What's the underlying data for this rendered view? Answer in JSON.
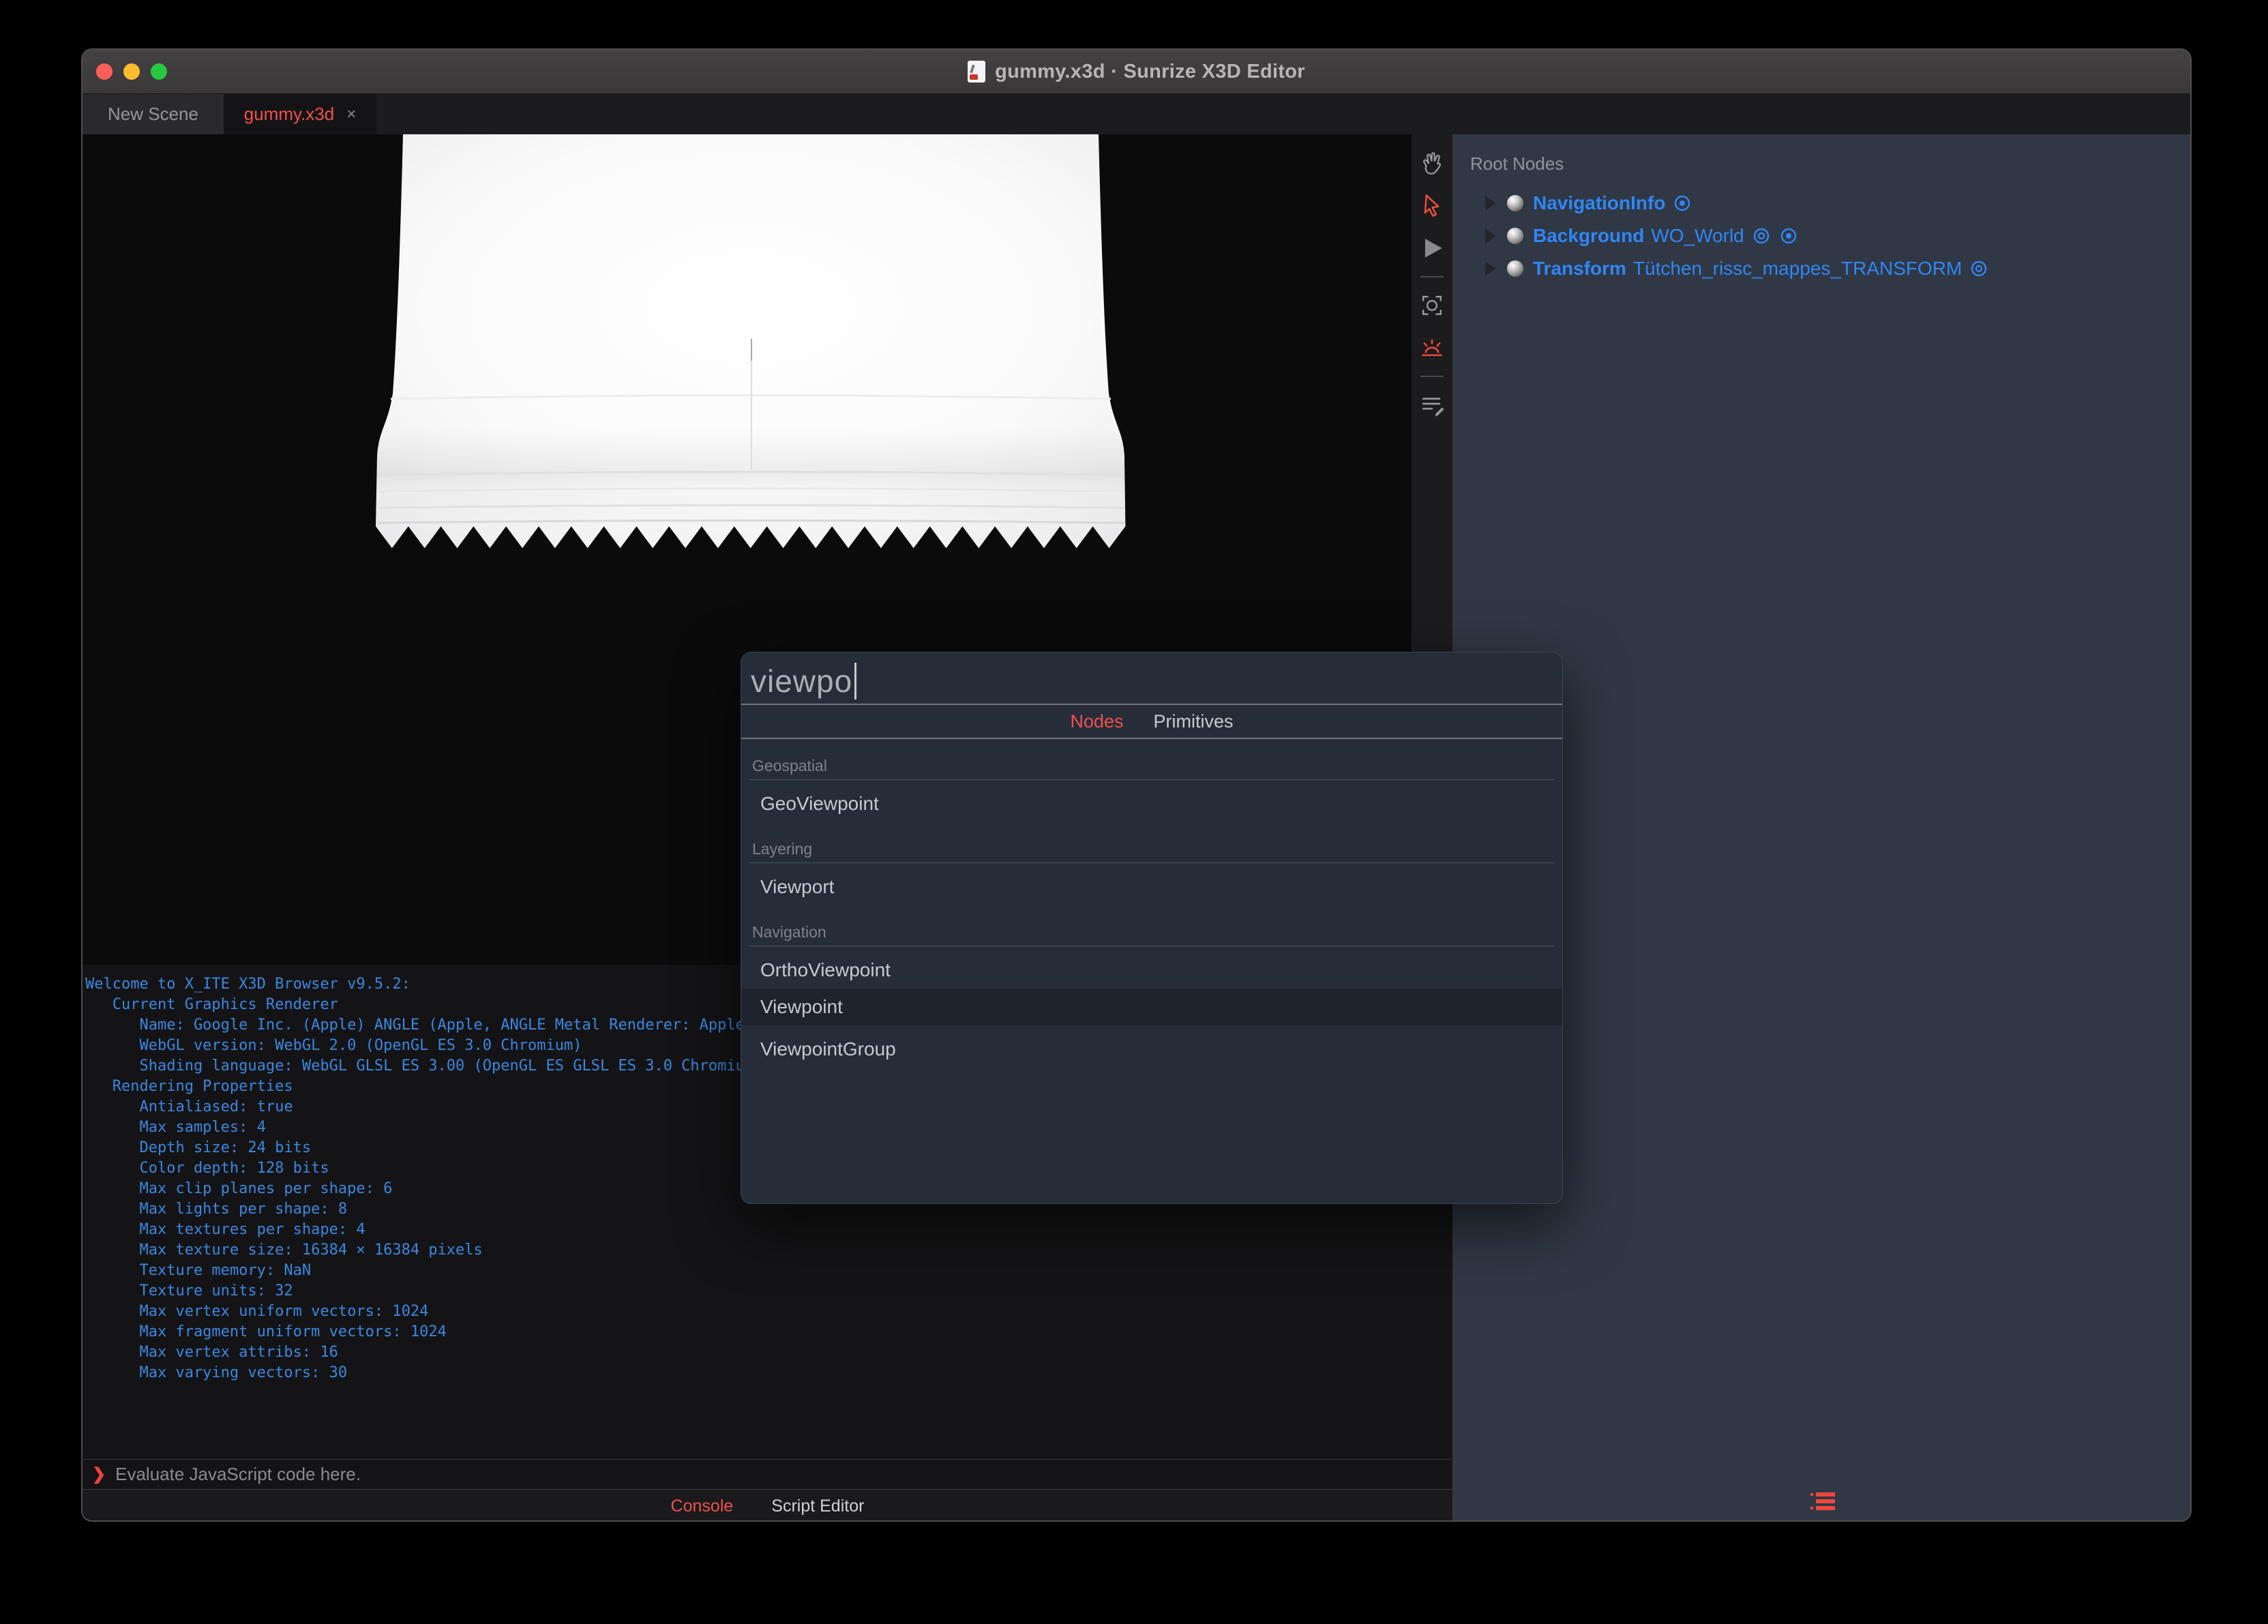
{
  "window": {
    "title": "gummy.x3d · Sunrize X3D Editor"
  },
  "traffic_lights": {
    "close_color": "#ff5f57",
    "minimize_color": "#febc2e",
    "zoom_color": "#28c841"
  },
  "tabs": {
    "items": [
      {
        "label": "New Scene"
      },
      {
        "label": "gummy.x3d",
        "close": "×"
      }
    ]
  },
  "toolbar": {
    "icons": [
      "pan-hand",
      "select-arrow",
      "play",
      "screenshot",
      "light",
      "script"
    ]
  },
  "outline": {
    "header": "Root Nodes",
    "nodes": [
      {
        "type": "NavigationInfo",
        "name": ""
      },
      {
        "type": "Background",
        "name": "WO_World"
      },
      {
        "type": "Transform",
        "name": "Tütchen_rissc_mappes_TRANSFORM"
      }
    ]
  },
  "console": {
    "lines": [
      "Welcome to X_ITE X3D Browser v9.5.2:",
      "   Current Graphics Renderer",
      "      Name: Google Inc. (Apple) ANGLE (Apple, ANGLE Metal Renderer: Apple",
      "      WebGL version: WebGL 2.0 (OpenGL ES 3.0 Chromium)",
      "      Shading language: WebGL GLSL ES 3.00 (OpenGL ES GLSL ES 3.0 Chromium",
      "   Rendering Properties",
      "      Antialiased: true",
      "      Max samples: 4",
      "      Depth size: 24 bits",
      "      Color depth: 128 bits",
      "      Max clip planes per shape: 6",
      "      Max lights per shape: 8",
      "      Max textures per shape: 4",
      "      Max texture size: 16384 × 16384 pixels",
      "      Texture memory: NaN",
      "      Texture units: 32",
      "      Max vertex uniform vectors: 1024",
      "      Max fragment uniform vectors: 1024",
      "      Max vertex attribs: 16",
      "      Max varying vectors: 30"
    ]
  },
  "prompt": {
    "chevron": "❯",
    "placeholder": "Evaluate JavaScript code here."
  },
  "panel_tabs": {
    "console": "Console",
    "script_editor": "Script Editor"
  },
  "dialog": {
    "query": "viewpo",
    "tabs": {
      "nodes": "Nodes",
      "primitives": "Primitives"
    },
    "selected_item": "Viewpoint",
    "sections": [
      {
        "label": "Geospatial",
        "items": [
          "GeoViewpoint"
        ]
      },
      {
        "label": "Layering",
        "items": [
          "Viewport"
        ]
      },
      {
        "label": "Navigation",
        "items": [
          "OrthoViewpoint",
          "Viewpoint",
          "ViewpointGroup"
        ]
      }
    ]
  },
  "colors": {
    "accent_red": "#f2504b",
    "node_blue": "#2f87f5",
    "console_blue": "#3b87e0"
  }
}
